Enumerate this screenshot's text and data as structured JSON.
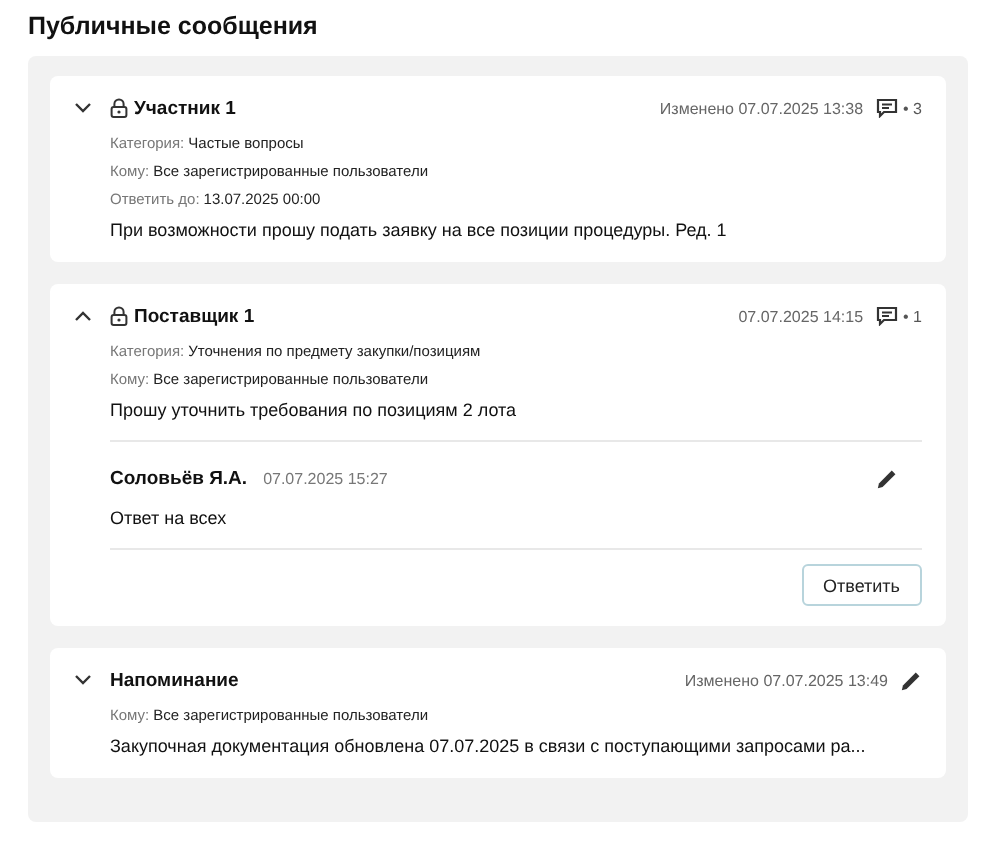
{
  "title": "Публичные сообщения",
  "messages": [
    {
      "kind": "thread",
      "expanded": false,
      "locked": true,
      "author": "Участник 1",
      "time": "Изменено 07.07.2025 13:38",
      "count": "• 3",
      "fields": [
        {
          "label": "Категория:",
          "value": "Частые вопросы"
        },
        {
          "label": "Кому:",
          "value": "Все зарегистрированные пользователи"
        },
        {
          "label": "Ответить до:",
          "value": "13.07.2025 00:00"
        }
      ],
      "body": "При возможности прошу подать заявку на все позиции процедуры. Ред. 1"
    },
    {
      "kind": "thread",
      "expanded": true,
      "locked": true,
      "author": "Поставщик 1",
      "time": "07.07.2025 14:15",
      "count": "• 1",
      "fields": [
        {
          "label": "Категория:",
          "value": "Уточнения по предмету закупки/позициям"
        },
        {
          "label": "Кому:",
          "value": "Все зарегистрированные пользователи"
        }
      ],
      "body": "Прошу уточнить требования по позициям 2 лота",
      "replies": [
        {
          "author": "Соловьёв Я.А.",
          "time": "07.07.2025 15:27",
          "text": "Ответ на всех"
        }
      ],
      "reply_button": "Ответить"
    },
    {
      "kind": "notice",
      "expanded": false,
      "locked": false,
      "author": "Напоминание",
      "time": "Изменено 07.07.2025 13:49",
      "fields": [
        {
          "label": "Кому:",
          "value": "Все зарегистрированные пользователи"
        }
      ],
      "body": "Закупочная документация обновлена 07.07.2025 в связи с поступающими запросами ра..."
    }
  ]
}
